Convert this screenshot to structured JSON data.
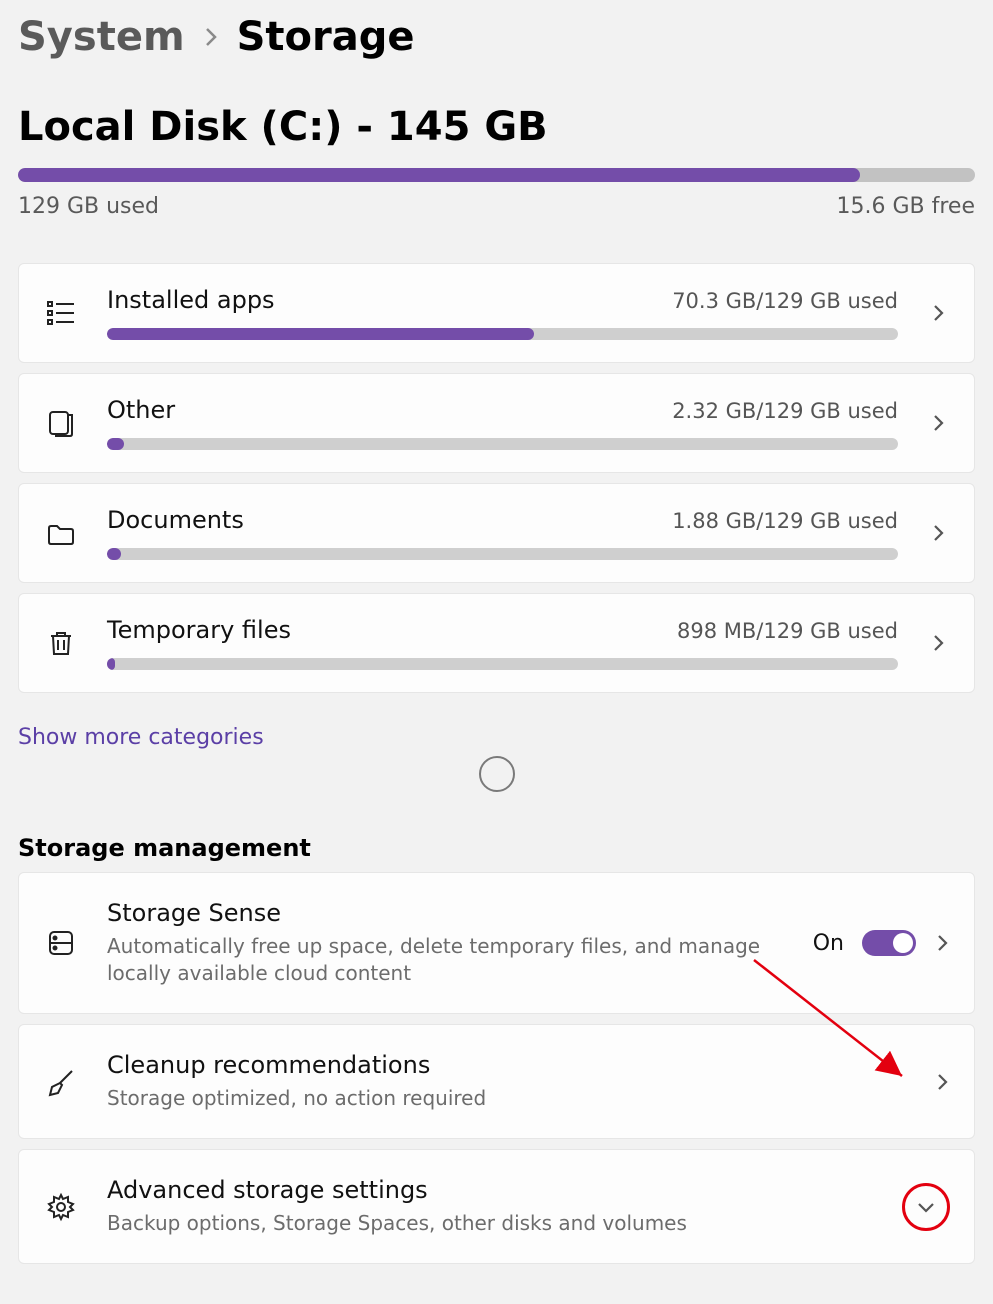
{
  "breadcrumb": {
    "parent": "System",
    "current": "Storage"
  },
  "disk": {
    "title": "Local Disk (C:) - 145 GB",
    "used_label": "129 GB used",
    "free_label": "15.6 GB free",
    "fill_pct": 88
  },
  "categories": [
    {
      "icon": "apps",
      "label": "Installed apps",
      "usage": "70.3 GB/129 GB used",
      "fill_pct": 54
    },
    {
      "icon": "other",
      "label": "Other",
      "usage": "2.32 GB/129 GB used",
      "fill_pct": 2.2
    },
    {
      "icon": "documents",
      "label": "Documents",
      "usage": "1.88 GB/129 GB used",
      "fill_pct": 1.8
    },
    {
      "icon": "trash",
      "label": "Temporary files",
      "usage": "898 MB/129 GB used",
      "fill_pct": 1
    }
  ],
  "show_more": "Show more categories",
  "section_heading": "Storage management",
  "management": [
    {
      "key": "storage-sense",
      "icon": "drive",
      "title": "Storage Sense",
      "desc": "Automatically free up space, delete temporary files, and manage locally available cloud content",
      "toggle": {
        "state_label": "On",
        "on": true
      },
      "chevron": "right"
    },
    {
      "key": "cleanup",
      "icon": "broom",
      "title": "Cleanup recommendations",
      "desc": "Storage optimized, no action required",
      "chevron": "right"
    },
    {
      "key": "advanced",
      "icon": "gear",
      "title": "Advanced storage settings",
      "desc": "Backup options, Storage Spaces, other disks and volumes",
      "chevron": "down"
    }
  ]
}
